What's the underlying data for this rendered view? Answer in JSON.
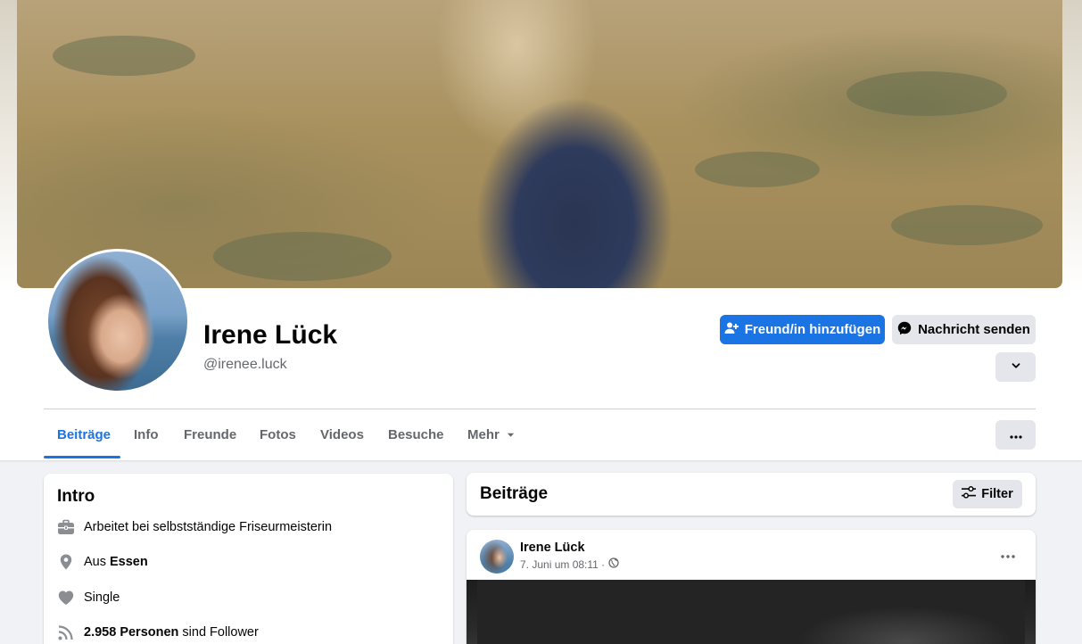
{
  "profile": {
    "name": "Irene Lück",
    "handle": "@irenee.luck"
  },
  "actions": {
    "add_friend_label": "Freund/in hinzufügen",
    "message_label": "Nachricht senden"
  },
  "tabs": [
    {
      "label": "Beiträge",
      "active": true
    },
    {
      "label": "Info"
    },
    {
      "label": "Freunde"
    },
    {
      "label": "Fotos"
    },
    {
      "label": "Videos"
    },
    {
      "label": "Besuche"
    },
    {
      "label": "Mehr"
    }
  ],
  "intro": {
    "title": "Intro",
    "work": "Arbeitet bei selbstständige Friseurmeisterin",
    "from_prefix": "Aus",
    "from_city": "Essen",
    "relationship": "Single",
    "followers_count": "2.958 Personen",
    "followers_suffix": "sind Follower"
  },
  "posts": {
    "title": "Beiträge",
    "filter_label": "Filter",
    "items": [
      {
        "author": "Irene Lück",
        "time": "7. Juni um 08:11 ·",
        "privacy_icon": "globe-icon"
      }
    ]
  },
  "colors": {
    "accent": "#1b74e4",
    "secondary_button": "#e4e6eb",
    "muted_text": "#65676b"
  }
}
